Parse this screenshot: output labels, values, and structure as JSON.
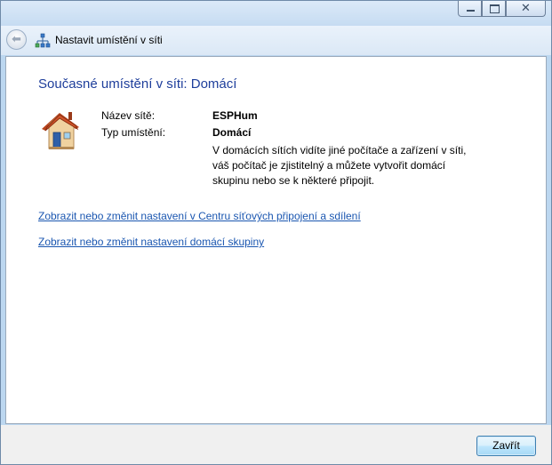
{
  "window": {
    "caption_buttons": {
      "minimize_icon": "minimize-icon",
      "maximize_icon": "maximize-icon",
      "close_icon": "close-icon",
      "close_glyph": "✕"
    }
  },
  "nav": {
    "back_glyph": "⬅",
    "title": "Nastavit umístění v síti"
  },
  "main": {
    "heading": "Současné umístění v síti: Domácí",
    "network_name_label": "Název sítě:",
    "network_name_value": "ESPHum",
    "location_type_label": "Typ umístění:",
    "location_type_value": "Domácí",
    "description": "V domácích sítích vidíte jiné počítače a zařízení v síti, váš počítač je zjistitelný a můžete vytvořit domácí skupinu nebo se k některé připojit.",
    "link_network_center": "Zobrazit nebo změnit nastavení v Centru síťových připojení a sdílení",
    "link_homegroup": "Zobrazit nebo změnit nastavení domácí skupiny"
  },
  "footer": {
    "close_label": "Zavřít"
  },
  "colors": {
    "heading": "#1e3e9b",
    "link": "#1a56b0"
  }
}
